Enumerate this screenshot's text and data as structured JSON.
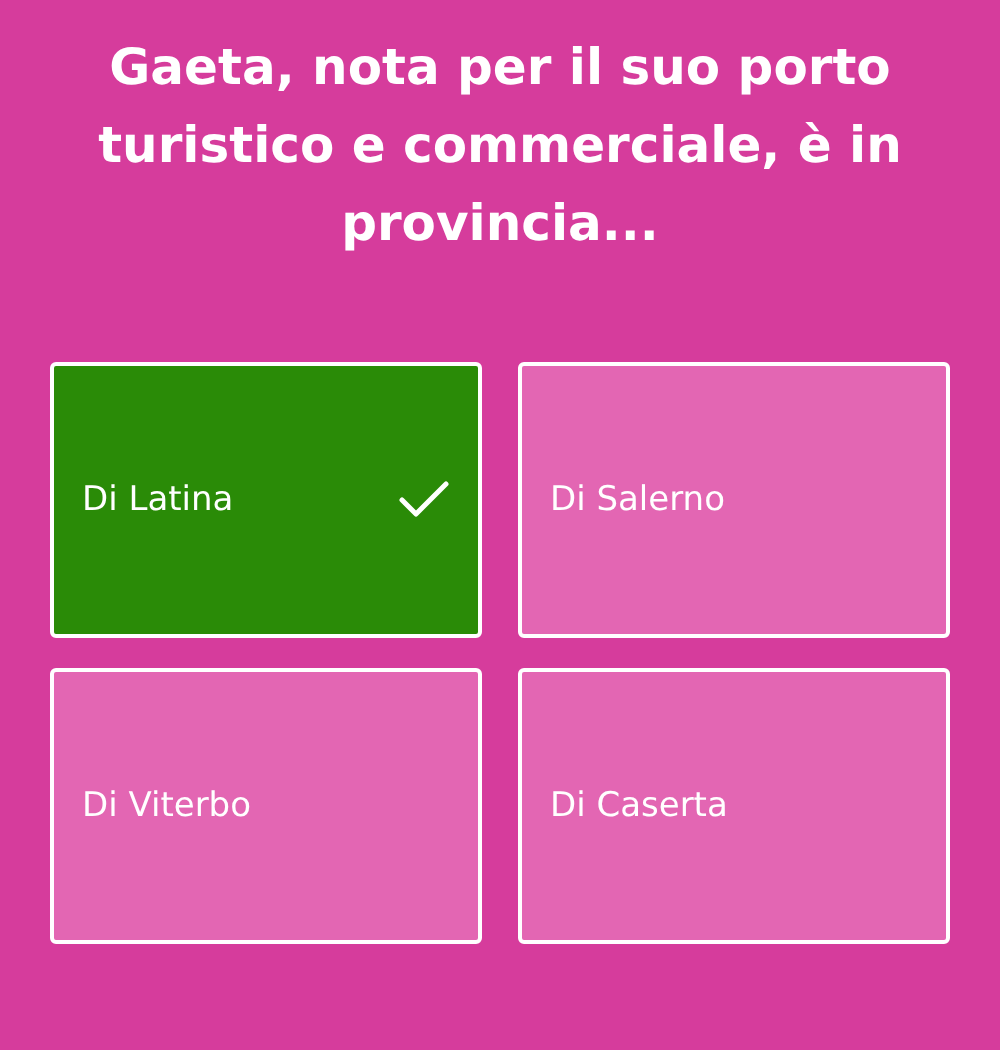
{
  "question": "Gaeta, nota per il suo porto turistico e commerciale, è in provincia...",
  "answers": [
    {
      "label": "Di Latina",
      "selected": true
    },
    {
      "label": "Di Salerno",
      "selected": false
    },
    {
      "label": "Di Viterbo",
      "selected": false
    },
    {
      "label": "Di Caserta",
      "selected": false
    }
  ]
}
